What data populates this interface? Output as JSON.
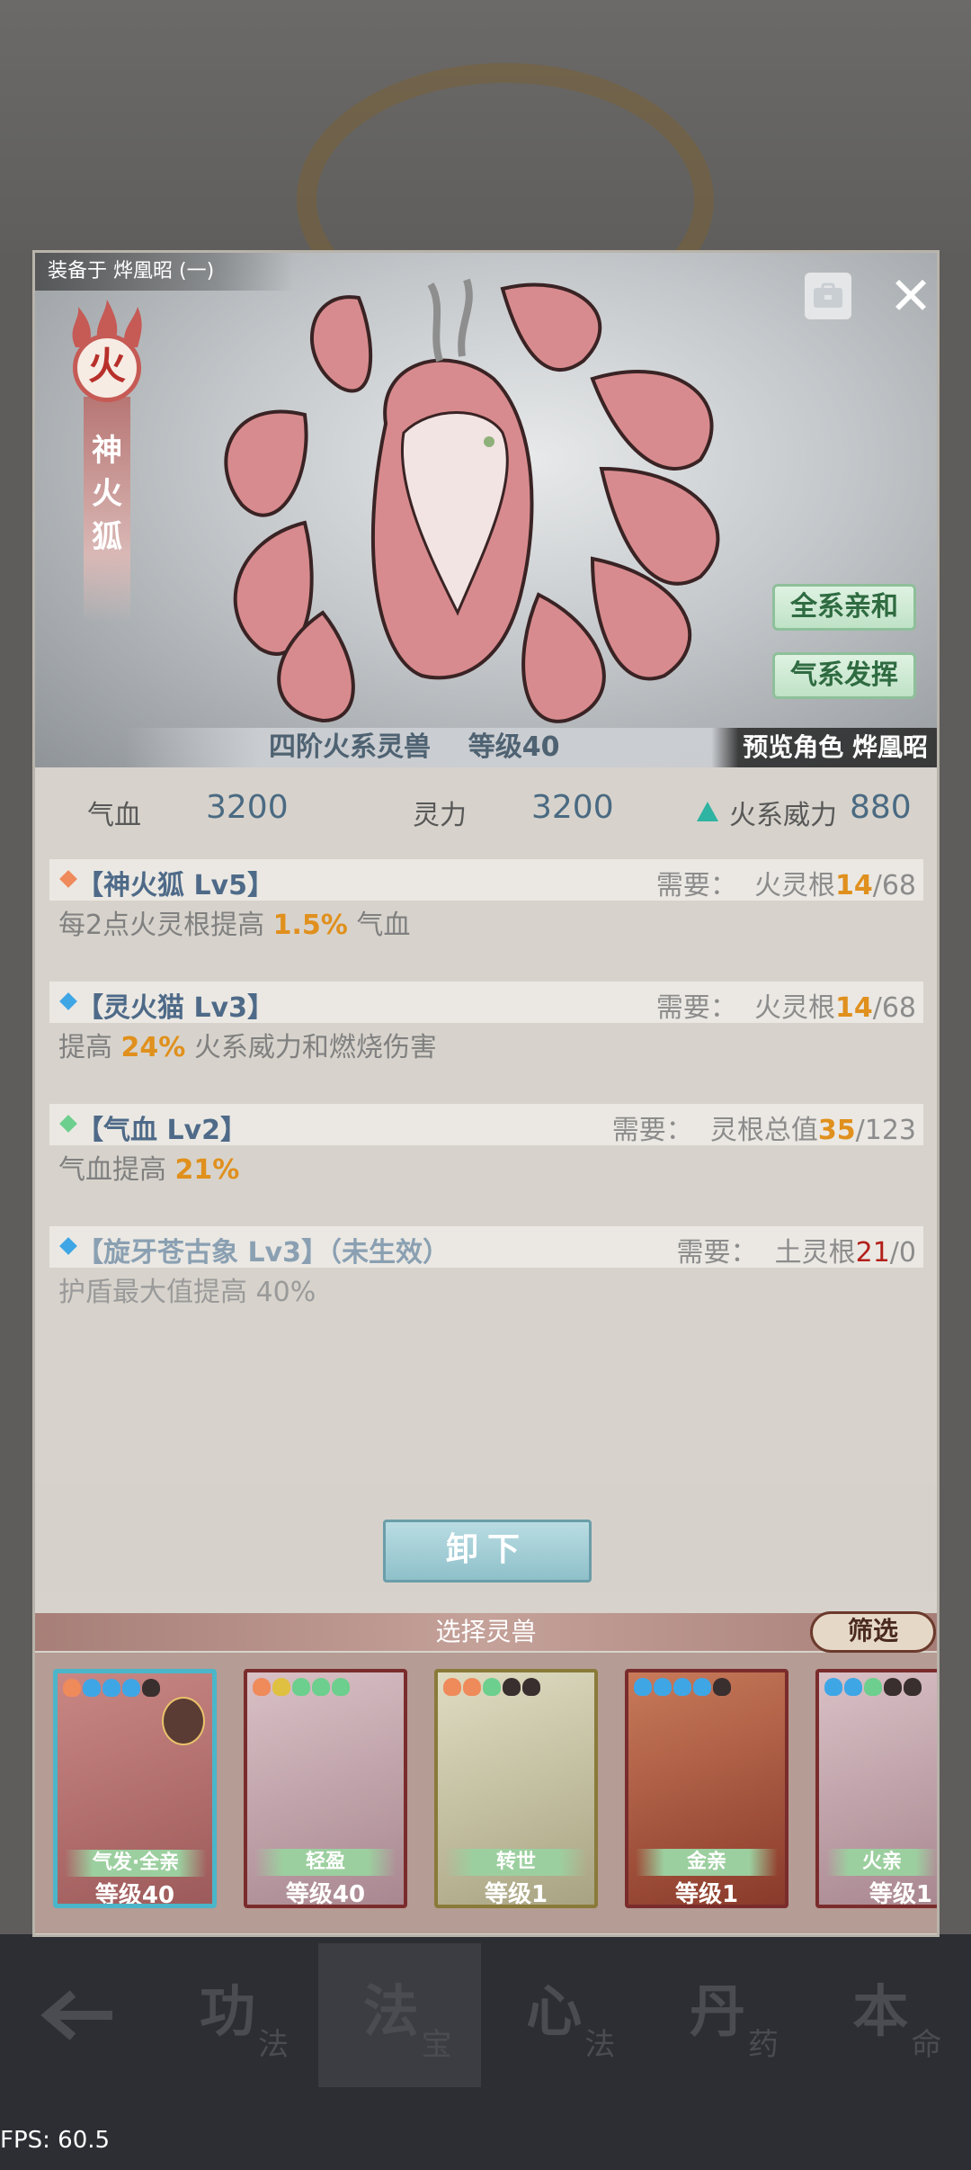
{
  "equip_label": "装备于 烨凰昭 (一)",
  "element_badge": "火",
  "beast_name": "神火狐",
  "traits": [
    "全系亲和",
    "气系发挥"
  ],
  "info": {
    "tier_text": "四阶火系灵兽",
    "level_text": "等级40",
    "preview_text": "预览角色 烨凰昭"
  },
  "stats": {
    "hp_label": "气血",
    "hp_value": "3200",
    "sp_label": "灵力",
    "sp_value": "3200",
    "power_label": "火系威力",
    "power_value": "880"
  },
  "skills": [
    {
      "title": "【神火狐 Lv5】",
      "req_label": "需要：",
      "req_root": "火灵根",
      "req_have": "14",
      "req_need": "/68",
      "desc_pre": "每2点火灵根提高 ",
      "desc_hl": "1.5%",
      "desc_post": " 气血",
      "diamond_color": "#ef8a5b"
    },
    {
      "title": "【灵火猫 Lv3】",
      "req_label": "需要：",
      "req_root": "火灵根",
      "req_have": "14",
      "req_need": "/68",
      "desc_pre": "提高 ",
      "desc_hl": "24%",
      "desc_post": " 火系威力和燃烧伤害",
      "diamond_color": "#3fa6e6"
    },
    {
      "title": "【气血 Lv2】",
      "req_label": "需要：",
      "req_root": "灵根总值",
      "req_have": "35",
      "req_need": "/123",
      "desc_pre": "气血提高 ",
      "desc_hl": "21%",
      "desc_post": "",
      "diamond_color": "#6ccf8d"
    },
    {
      "title": "【旋牙苍古象 Lv3】（未生效）",
      "req_label": "需要：",
      "req_root": "土灵根",
      "req_have": "21",
      "req_need": "/0",
      "desc_pre": "护盾最大值提高 40%",
      "desc_hl": "",
      "desc_post": "",
      "diamond_color": "#3fa6e6"
    }
  ],
  "unequip_label": "卸下",
  "select_title": "选择灵兽",
  "filter_label": "筛选",
  "cards": [
    {
      "tag": "气发·全亲",
      "level": "等级40",
      "bg": "#b46e6b",
      "dots": [
        "#ef8a5b",
        "#3fa6e6",
        "#3fa6e6",
        "#3fa6e6",
        "#3a2f2f"
      ]
    },
    {
      "tag": "轻盈",
      "level": "等级40",
      "bg": "#c6a7ad",
      "dots": [
        "#ef8a5b",
        "#e0c040",
        "#6ccf8d",
        "#6ccf8d",
        "#6ccf8d"
      ]
    },
    {
      "tag": "转世",
      "level": "等级1",
      "bg": "#c9c4a8",
      "dots": [
        "#ef8a5b",
        "#ef8a5b",
        "#6ccf8d",
        "#3a2f2f",
        "#3a2f2f"
      ]
    },
    {
      "tag": "金亲",
      "level": "等级1",
      "bg": "#b45a3c",
      "dots": [
        "#3fa6e6",
        "#3fa6e6",
        "#3fa6e6",
        "#3fa6e6",
        "#3a2f2f"
      ]
    },
    {
      "tag": "火亲",
      "level": "等级1",
      "bg": "#c6a7ad",
      "dots": [
        "#3fa6e6",
        "#3fa6e6",
        "#6ccf8d",
        "#3a2f2f",
        "#3a2f2f"
      ]
    }
  ],
  "nav": [
    {
      "main": "功",
      "sub": "法"
    },
    {
      "main": "法",
      "sub": "宝"
    },
    {
      "main": "心",
      "sub": "法"
    },
    {
      "main": "丹",
      "sub": "药"
    },
    {
      "main": "本",
      "sub": "命"
    }
  ],
  "fps": "FPS: 60.5"
}
